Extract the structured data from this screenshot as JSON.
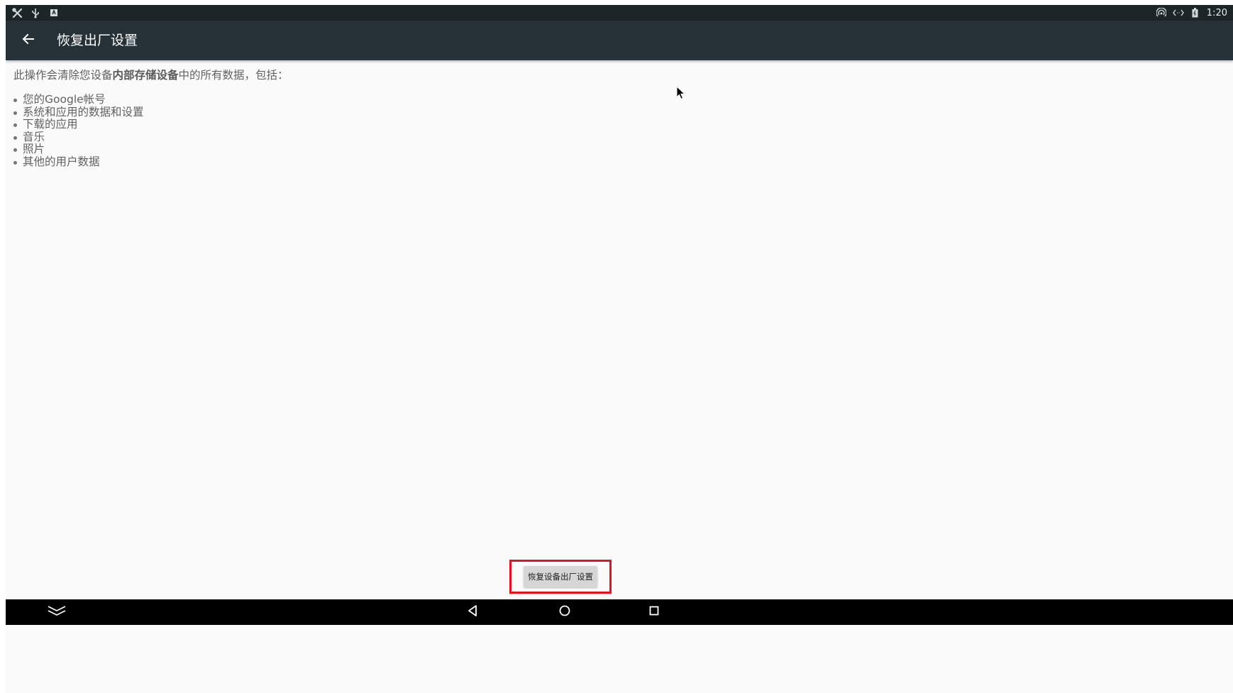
{
  "status_bar": {
    "time": "1:20",
    "left_icons": [
      "tools-icon",
      "usb-icon",
      "android-debug-icon"
    ],
    "right_icons": [
      "hotspot-icon",
      "data-sync-icon",
      "battery-icon"
    ]
  },
  "app_bar": {
    "title": "恢复出厂设置",
    "back_icon": "arrow-left-icon"
  },
  "content": {
    "intro_prefix": "此操作会清除您设备",
    "intro_bold": "内部存储设备",
    "intro_suffix": "中的所有数据，包括：",
    "items": [
      "您的Google帐号",
      "系统和应用的数据和设置",
      "下载的应用",
      "音乐",
      "照片",
      "其他的用户数据"
    ]
  },
  "reset_button": {
    "label": "恢复设备出厂设置",
    "highlight_color": "#e5131f"
  },
  "nav_bar": {
    "icons": [
      "collapse-icon",
      "back-triangle-icon",
      "home-circle-icon",
      "recents-square-icon"
    ]
  },
  "colors": {
    "status_bar": "#1d2529",
    "app_bar": "#263238",
    "background": "#fafafa",
    "nav_bar": "#000000"
  }
}
